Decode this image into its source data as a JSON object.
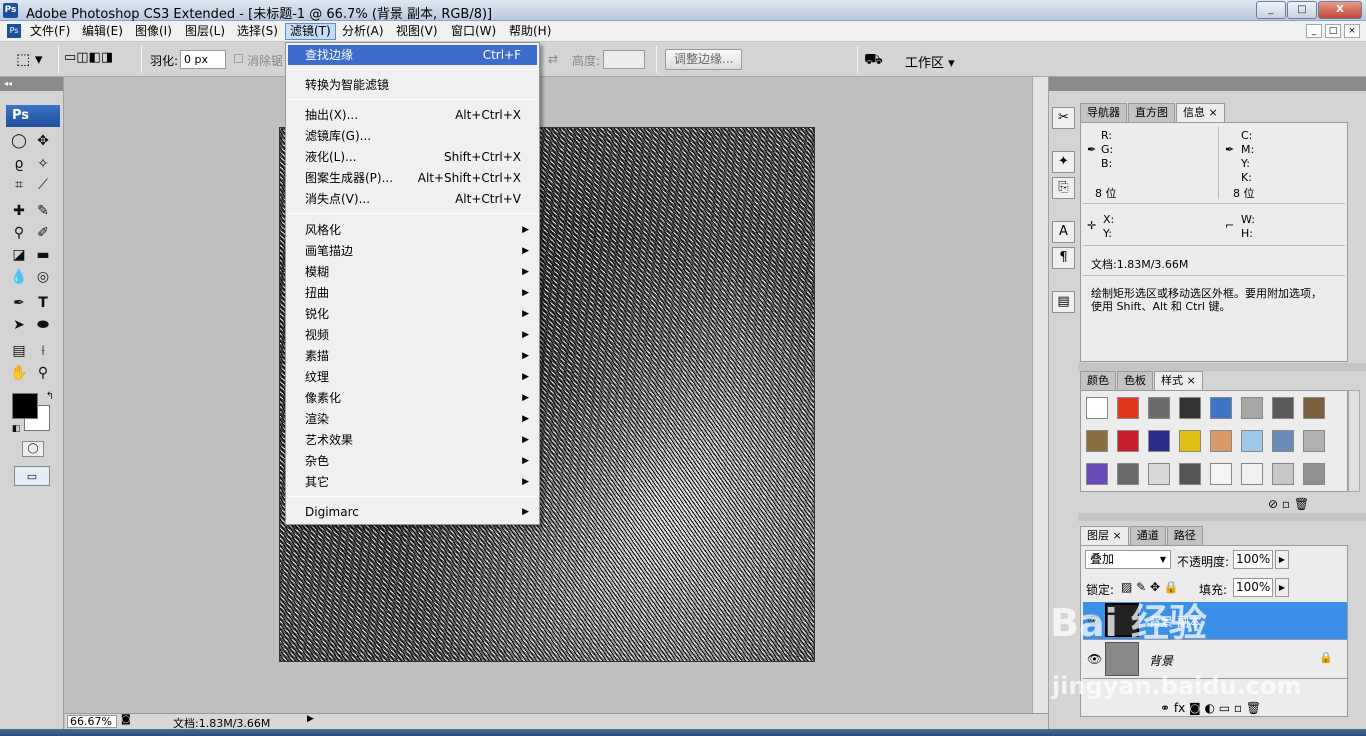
{
  "window": {
    "title": "Adobe Photoshop CS3 Extended - [未标题-1 @ 66.7% (背景 副本, RGB/8)]",
    "app_icon": "Ps",
    "controls": {
      "minimize": "_",
      "maximize": "□",
      "close": "X"
    }
  },
  "menubar": {
    "items": [
      "文件(F)",
      "编辑(E)",
      "图像(I)",
      "图层(L)",
      "选择(S)",
      "滤镜(T)",
      "分析(A)",
      "视图(V)",
      "窗口(W)",
      "帮助(H)"
    ],
    "active": "滤镜(T)"
  },
  "options": {
    "feather_label": "羽化:",
    "feather_value": "0 px",
    "antialias_label": "消除锯",
    "height_label": "高度:",
    "refine_edge": "调整边缘...",
    "workspace": "工作区 ▾"
  },
  "toolbox": {
    "badge": "Ps",
    "icons": [
      "marquee-icon",
      "move-icon",
      "lasso-icon",
      "magic-wand-icon",
      "crop-icon",
      "slice-icon",
      "healing-icon",
      "brush-icon",
      "stamp-icon",
      "history-brush-icon",
      "eraser-icon",
      "gradient-icon",
      "blur-icon",
      "dodge-icon",
      "pen-icon",
      "type-icon",
      "path-select-icon",
      "shape-icon",
      "notes-icon",
      "eyedropper-icon",
      "hand-icon",
      "zoom-icon"
    ],
    "fg_color": "#000000",
    "bg_color": "#ffffff"
  },
  "filter_menu": {
    "items": [
      {
        "label": "查找边缘",
        "shortcut": "Ctrl+F",
        "highlighted": true
      },
      {
        "label": "转换为智能滤镜",
        "shortcut": ""
      },
      {
        "label": "抽出(X)...",
        "shortcut": "Alt+Ctrl+X"
      },
      {
        "label": "滤镜库(G)...",
        "shortcut": ""
      },
      {
        "label": "液化(L)...",
        "shortcut": "Shift+Ctrl+X"
      },
      {
        "label": "图案生成器(P)...",
        "shortcut": "Alt+Shift+Ctrl+X"
      },
      {
        "label": "消失点(V)...",
        "shortcut": "Alt+Ctrl+V"
      },
      {
        "label": "风格化",
        "submenu": true
      },
      {
        "label": "画笔描边",
        "submenu": true
      },
      {
        "label": "模糊",
        "submenu": true
      },
      {
        "label": "扭曲",
        "submenu": true
      },
      {
        "label": "锐化",
        "submenu": true
      },
      {
        "label": "视频",
        "submenu": true
      },
      {
        "label": "素描",
        "submenu": true
      },
      {
        "label": "纹理",
        "submenu": true
      },
      {
        "label": "像素化",
        "submenu": true
      },
      {
        "label": "渲染",
        "submenu": true
      },
      {
        "label": "艺术效果",
        "submenu": true
      },
      {
        "label": "杂色",
        "submenu": true
      },
      {
        "label": "其它",
        "submenu": true
      },
      {
        "label": "Digimarc",
        "submenu": true
      }
    ]
  },
  "statusbar": {
    "zoom": "66.67%",
    "doc_size": "文档:1.83M/3.66M"
  },
  "info_panel": {
    "tabs": [
      "导航器",
      "直方图",
      "信息"
    ],
    "active_tab": "信息",
    "rgb": {
      "r": "R:",
      "g": "G:",
      "b": "B:"
    },
    "cmyk": {
      "c": "C:",
      "m": "M:",
      "y": "Y:",
      "k": "K:"
    },
    "bits_left": "8 位",
    "bits_right": "8 位",
    "xy": {
      "x": "X:",
      "y": "Y:"
    },
    "wh": {
      "w": "W:",
      "h": "H:"
    },
    "doc_size": "文档:1.83M/3.66M",
    "hint_line1": "绘制矩形选区或移动选区外框。要用附加选项，",
    "hint_line2": "使用 Shift、Alt 和 Ctrl 键。"
  },
  "styles_panel": {
    "tabs": [
      "颜色",
      "色板",
      "样式"
    ],
    "active_tab": "样式",
    "swatches": [
      "#ffffff",
      "#e2361b",
      "#6b6b6b",
      "#333333",
      "#3f73c8",
      "#a8a8a8",
      "#5a5a5a",
      "#7a6040",
      "#8a7040",
      "#c8202a",
      "#2a2a8a",
      "#e0c010",
      "#d99a6a",
      "#9fc7e8",
      "#6a8ab8",
      "#b0b0b0",
      "#6a4ab8",
      "#6a6a6a",
      "#d8d8d8",
      "#555555",
      "#f4f4f4",
      "#f0f0f0",
      "#c8c8c8",
      "#909090"
    ]
  },
  "layers_panel": {
    "tabs": [
      "图层",
      "通道",
      "路径"
    ],
    "active_tab": "图层",
    "blend_mode": "叠加",
    "opacity_label": "不透明度:",
    "opacity": "100%",
    "lock_label": "锁定:",
    "fill_label": "填充:",
    "fill": "100%",
    "layers": [
      {
        "name": "背景 副本",
        "selected": true
      },
      {
        "name": "背景",
        "selected": false
      }
    ]
  },
  "watermark": {
    "text": "Bai 经验",
    "url": "jingyan.baidu.com"
  }
}
